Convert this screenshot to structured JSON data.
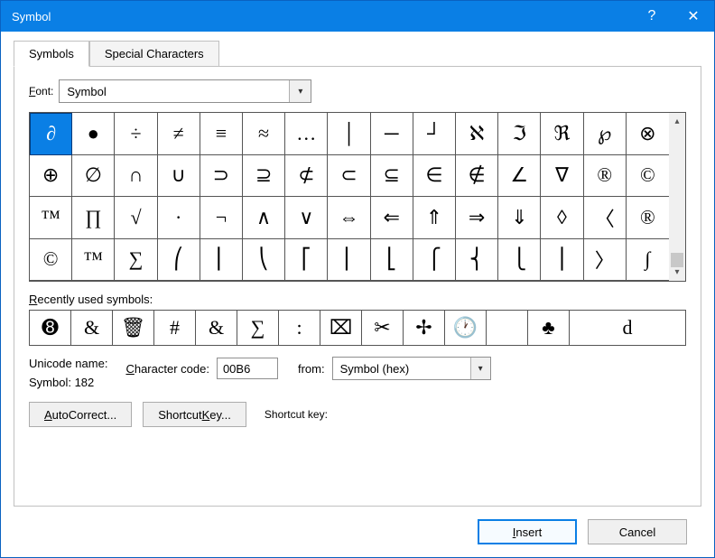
{
  "title": "Symbol",
  "tabs": [
    "Symbols",
    "Special Characters"
  ],
  "font_label": "Font:",
  "font_value": "Symbol",
  "grid": [
    "∂",
    "●",
    "÷",
    "≠",
    "≡",
    "≈",
    "…",
    "│",
    "─",
    "┘",
    "ℵ",
    "ℑ",
    "ℜ",
    "℘",
    "⊗",
    "⊕",
    "∅",
    "∩",
    "∪",
    "⊃",
    "⊇",
    "⊄",
    "⊂",
    "⊆",
    "∈",
    "∉",
    "∠",
    "∇",
    "®",
    "©",
    "™",
    "∏",
    "√",
    "·",
    "¬",
    "∧",
    "∨",
    "⇔",
    "⇐",
    "⇑",
    "⇒",
    "⇓",
    "◊",
    "〈",
    "®",
    "©",
    "™",
    "∑",
    "⎛",
    "⎜",
    "⎝",
    "⎡",
    "⎢",
    "⎣",
    "⎧",
    "⎨",
    "⎩",
    "⎪",
    "〉",
    "∫"
  ],
  "selected_index": 0,
  "recent_label": "Recently used symbols:",
  "recent": [
    "➑",
    "&",
    "🗑",
    "#",
    "&",
    "∑",
    ":",
    "⌧",
    "✂",
    "✢",
    "🕐",
    "",
    "♣",
    "d"
  ],
  "unicode_name_label": "Unicode name:",
  "unicode_name_value": "Symbol: 182",
  "char_code_label": "Character code:",
  "char_code_value": "00B6",
  "from_label": "from:",
  "from_value": "Symbol (hex)",
  "autocorrect_btn": "AutoCorrect...",
  "shortcutkey_btn": "Shortcut Key...",
  "shortcutkey_label": "Shortcut key:",
  "insert_btn": "Insert",
  "cancel_btn": "Cancel"
}
